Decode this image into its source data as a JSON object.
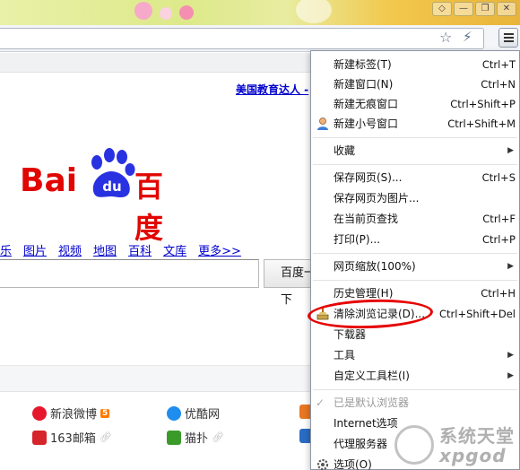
{
  "window": {
    "controls": [
      "shirt-icon",
      "minimize-icon",
      "restore-icon",
      "close-icon"
    ]
  },
  "toolbar": {
    "icons": [
      "bookmark-star-icon",
      "lightning-icon",
      "menu-icon"
    ]
  },
  "page": {
    "promo_link": "美国教育达人 -",
    "logo": {
      "latin": "Bai",
      "paw_text": "du",
      "chinese": "百度"
    },
    "search_tabs": [
      "音乐",
      "图片",
      "视频",
      "地图",
      "百科",
      "文库",
      "更多>>"
    ],
    "search_button": "百度一下",
    "sites": [
      {
        "name": "新浪微博",
        "badge": "5",
        "icon": "weibo-icon",
        "color": "#e6162d"
      },
      {
        "name": "优酷网",
        "icon": "youku-icon",
        "color": "#1f8ded"
      },
      {
        "name": "163邮箱",
        "icon": "mail163-icon",
        "color": "#d5242a"
      },
      {
        "name": "猫扑",
        "icon": "mop-icon",
        "color": "#3a9b2a"
      }
    ]
  },
  "menu": {
    "groups": [
      [
        {
          "label": "新建标签(T)",
          "shortcut": "Ctrl+T"
        },
        {
          "label": "新建窗口(N)",
          "shortcut": "Ctrl+N"
        },
        {
          "label": "新建无痕窗口",
          "shortcut": "Ctrl+Shift+P"
        },
        {
          "label": "新建小号窗口",
          "shortcut": "Ctrl+Shift+M",
          "icon": "user-icon"
        }
      ],
      [
        {
          "label": "收藏",
          "submenu": true
        }
      ],
      [
        {
          "label": "保存网页(S)...",
          "shortcut": "Ctrl+S"
        },
        {
          "label": "保存网页为图片..."
        },
        {
          "label": "在当前页查找",
          "shortcut": "Ctrl+F"
        },
        {
          "label": "打印(P)...",
          "shortcut": "Ctrl+P"
        }
      ],
      [
        {
          "label": "网页缩放(100%)",
          "submenu": true
        }
      ],
      [
        {
          "label": "历史管理(H)",
          "shortcut": "Ctrl+H"
        },
        {
          "label": "清除浏览记录(D)...",
          "shortcut": "Ctrl+Shift+Del",
          "icon": "clear-history-icon"
        },
        {
          "label": "下载器"
        },
        {
          "label": "工具",
          "submenu": true
        },
        {
          "label": "自定义工具栏(I)",
          "submenu": true
        }
      ],
      [
        {
          "label": "已是默认浏览器",
          "disabled": true,
          "icon": "checkmark-icon"
        },
        {
          "label": "Internet选项"
        },
        {
          "label": "代理服务器"
        },
        {
          "label": "选项(O)",
          "icon": "gear-icon"
        }
      ]
    ]
  },
  "watermark": {
    "top": "系统天堂",
    "bottom": "xpgod"
  }
}
